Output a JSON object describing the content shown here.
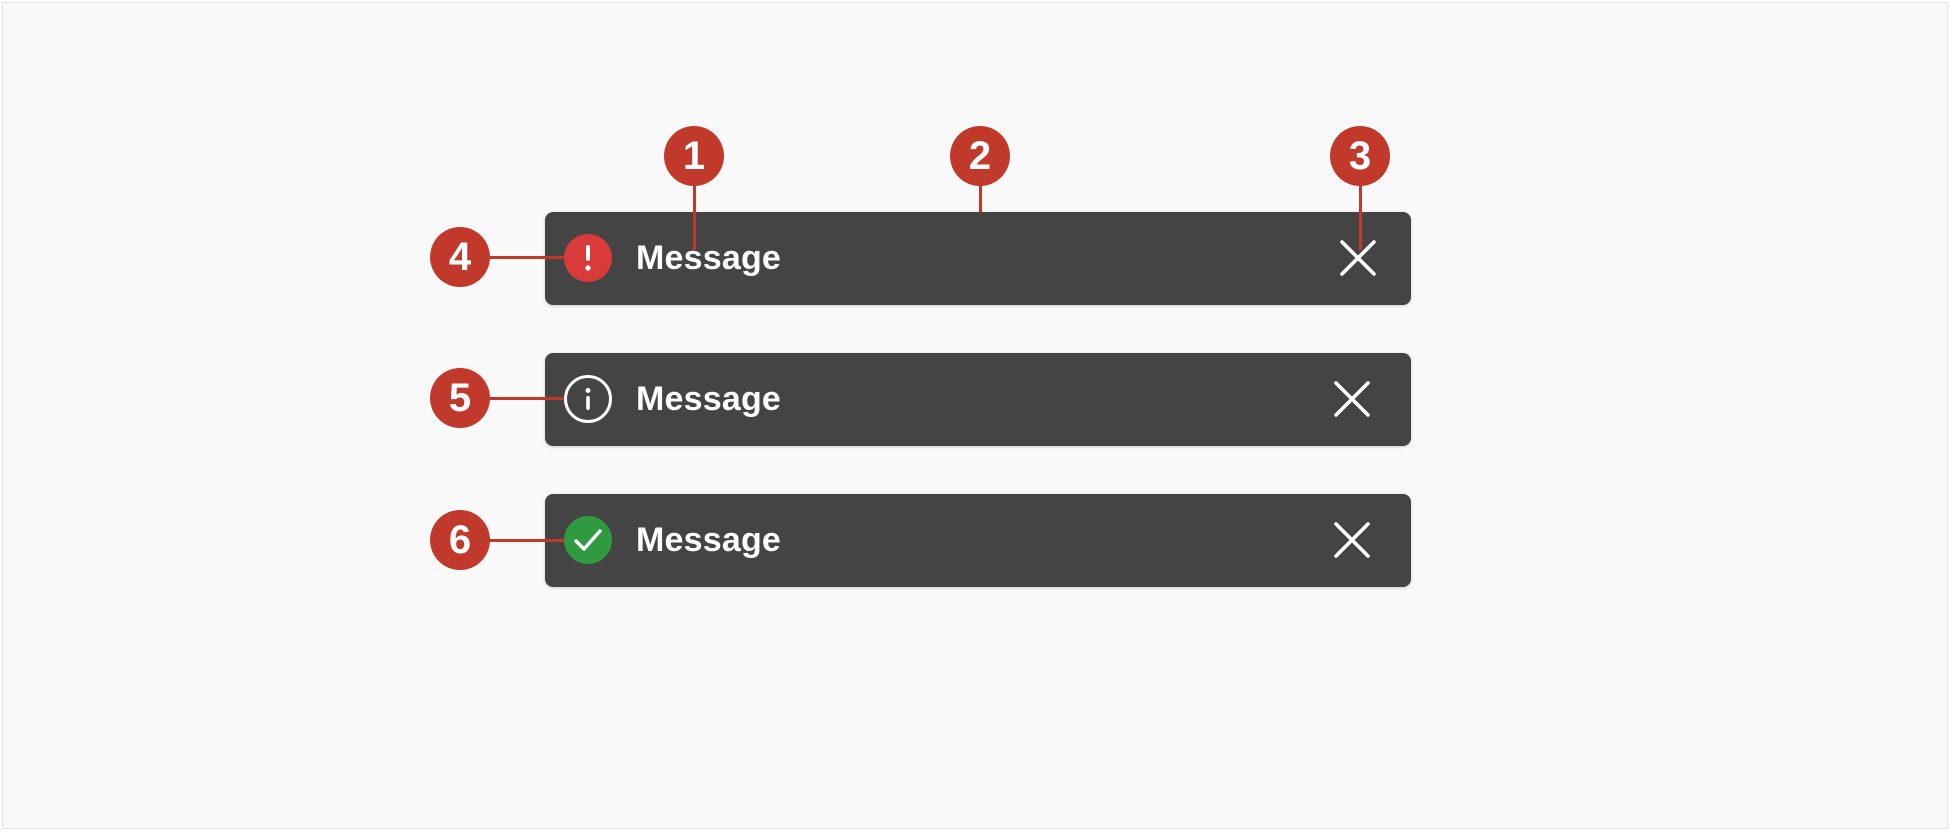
{
  "colors": {
    "toast_background": "#444444",
    "callout": "#c0392b",
    "error": "#d93a3a",
    "success": "#2f9a3f",
    "text": "#ffffff"
  },
  "toasts": [
    {
      "type": "error",
      "icon": "error-icon",
      "message": "Message",
      "close_icon": "close-icon"
    },
    {
      "type": "info",
      "icon": "info-icon",
      "message": "Message",
      "close_icon": "close-icon"
    },
    {
      "type": "success",
      "icon": "checkmark-icon",
      "message": "Message",
      "close_icon": "close-icon"
    }
  ],
  "callouts": [
    "1",
    "2",
    "3",
    "4",
    "5",
    "6"
  ]
}
